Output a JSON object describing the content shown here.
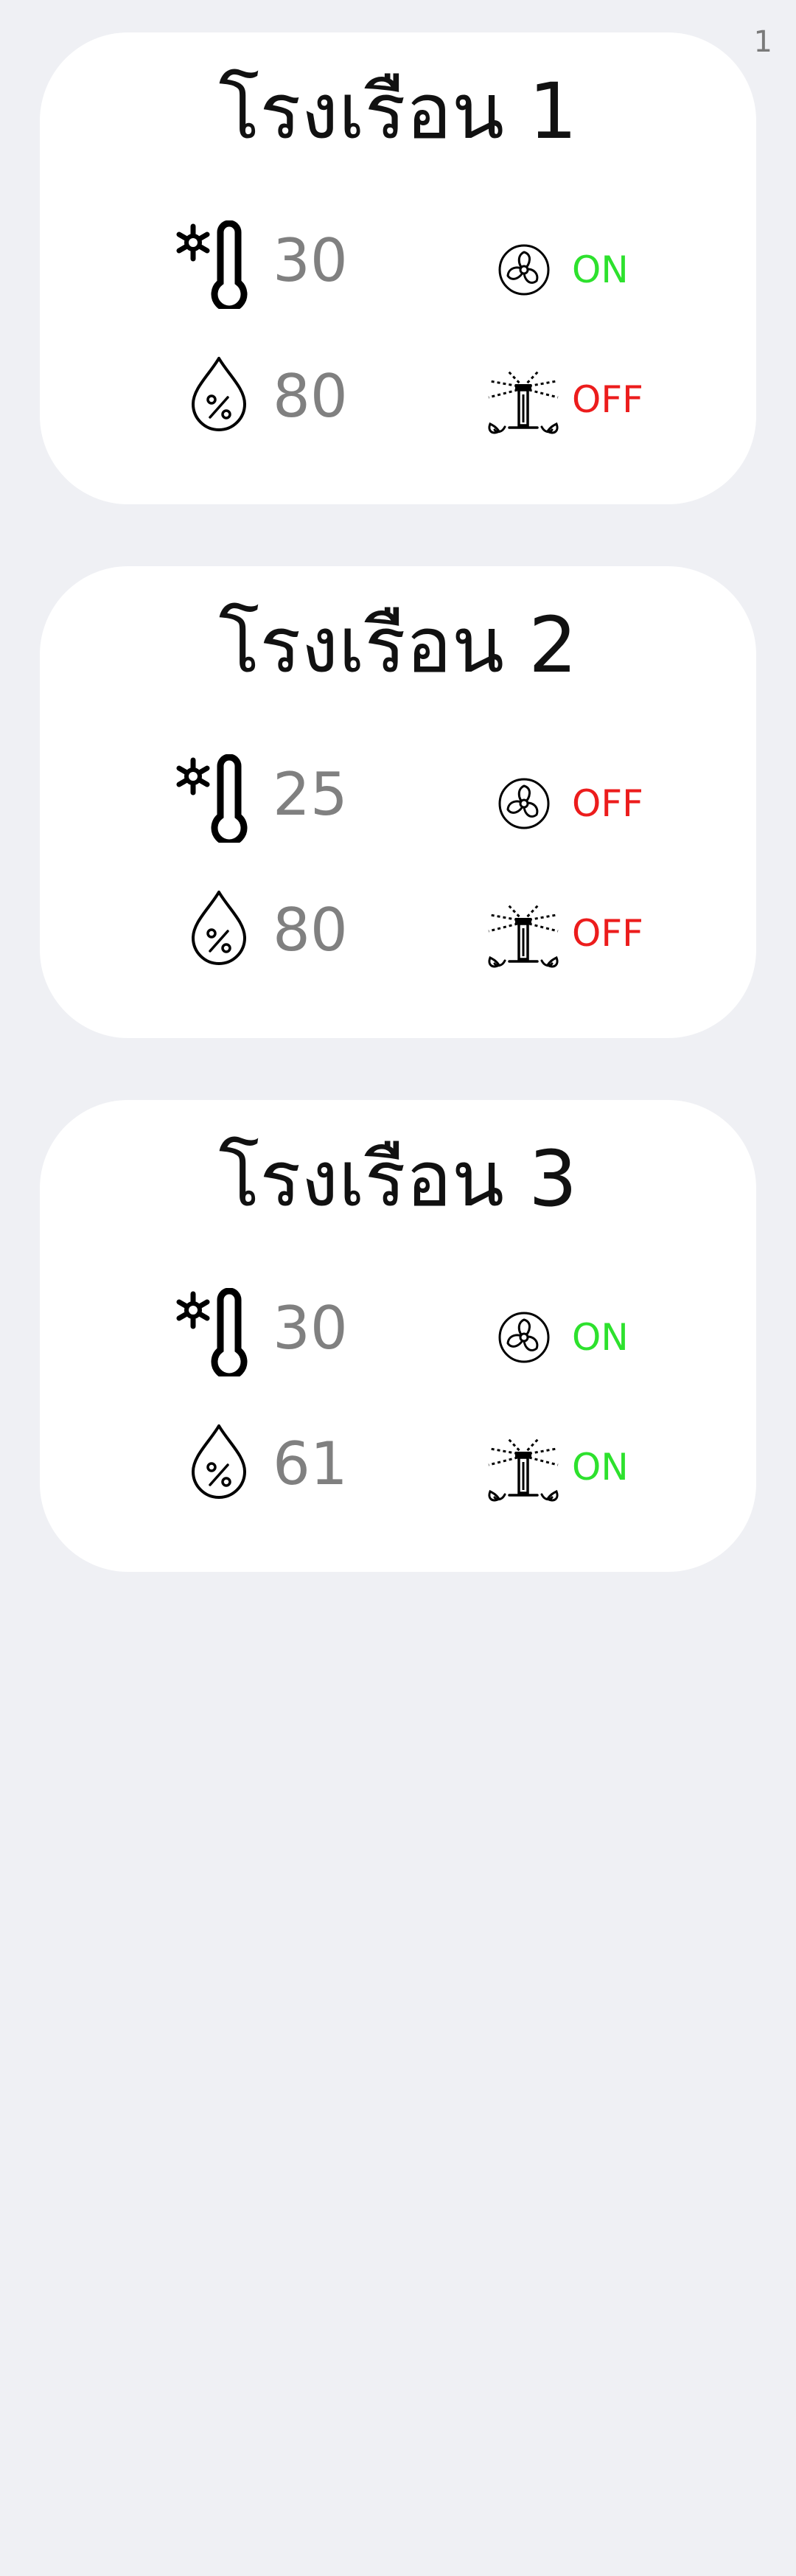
{
  "page_number": "1",
  "greenhouses": [
    {
      "name": "โรงเรือน 1",
      "temperature": "30",
      "humidity": "80",
      "fan_status": "ON",
      "sprinkler_status": "OFF"
    },
    {
      "name": "โรงเรือน 2",
      "temperature": "25",
      "humidity": "80",
      "fan_status": "OFF",
      "sprinkler_status": "OFF"
    },
    {
      "name": "โรงเรือน 3",
      "temperature": "30",
      "humidity": "61",
      "fan_status": "ON",
      "sprinkler_status": "ON"
    }
  ],
  "colors": {
    "background": "#eff0f4",
    "card": "#ffffff",
    "reading": "#808080",
    "on": "#2de12d",
    "off": "#ec1c1c"
  },
  "icons": {
    "temperature": "thermometer-snowflake-icon",
    "humidity": "humidity-drop-icon",
    "fan": "fan-icon",
    "sprinkler": "sprinkler-icon"
  }
}
